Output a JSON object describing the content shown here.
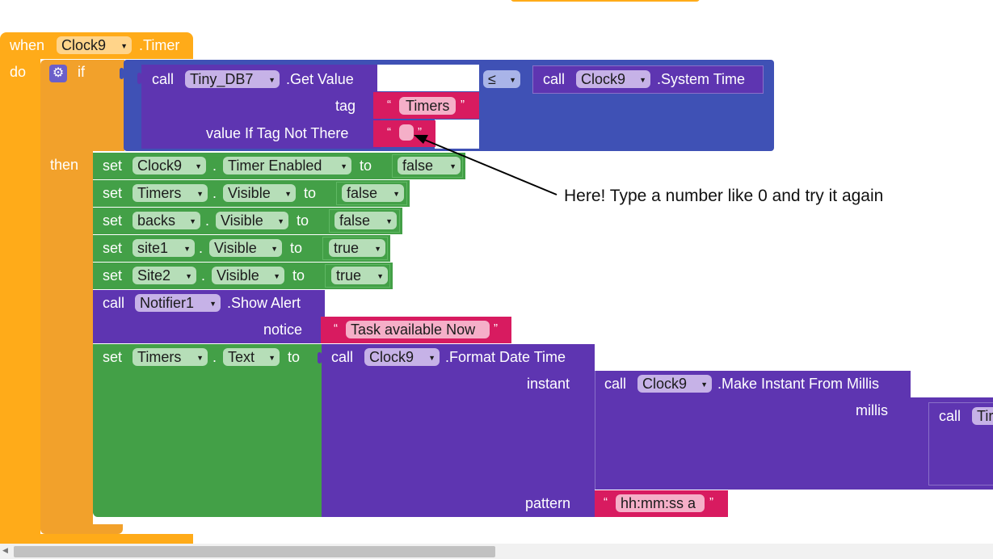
{
  "event": {
    "when": "when",
    "component": "Clock9",
    "event": ".Timer",
    "do": "do"
  },
  "if_block": {
    "if": "if",
    "then": "then"
  },
  "get_value": {
    "call": "call",
    "component": "Tiny_DB7",
    "method": ".Get Value",
    "tag_label": "tag",
    "tag_value": "Timers",
    "default_label": "value If Tag Not There",
    "default_value": ""
  },
  "compare": {
    "op": "≤"
  },
  "system_time": {
    "call": "call",
    "component": "Clock9",
    "method": ".System Time"
  },
  "sets": [
    {
      "set": "set",
      "component": "Clock9",
      "dot": ".",
      "property": "Timer Enabled",
      "to": "to",
      "value": "false"
    },
    {
      "set": "set",
      "component": "Timers",
      "dot": ".",
      "property": "Visible",
      "to": "to",
      "value": "false"
    },
    {
      "set": "set",
      "component": "backs",
      "dot": ".",
      "property": "Visible",
      "to": "to",
      "value": "false"
    },
    {
      "set": "set",
      "component": "site1",
      "dot": ".",
      "property": "Visible",
      "to": "to",
      "value": "true"
    },
    {
      "set": "set",
      "component": "Site2",
      "dot": ".",
      "property": "Visible",
      "to": "to",
      "value": "true"
    }
  ],
  "show_alert": {
    "call": "call",
    "component": "Notifier1",
    "method": ".Show Alert",
    "notice_label": "notice",
    "notice_value": "Task available Now"
  },
  "set_text": {
    "set": "set",
    "component": "Timers",
    "dot": ".",
    "property": "Text",
    "to": "to"
  },
  "format": {
    "call": "call",
    "component": "Clock9",
    "method": ".Format Date Time",
    "instant_label": "instant",
    "pattern_label": "pattern",
    "pattern_value": "hh:mm:ss a"
  },
  "make_instant": {
    "call": "call",
    "component": "Clock9",
    "method": ".Make Instant From Millis",
    "millis_label": "millis"
  },
  "clipped": {
    "call": "call",
    "component": "Tir"
  },
  "annotation": "Here! Type a number like 0 and try it again",
  "quote_open": "“",
  "quote_close": "”",
  "colors": {
    "event": "#FFAB19",
    "control": "#F2A12B",
    "tinydb": "#5E35B1",
    "logic": "#3F51B5",
    "setter": "#43A047",
    "text": "#D81B60"
  }
}
